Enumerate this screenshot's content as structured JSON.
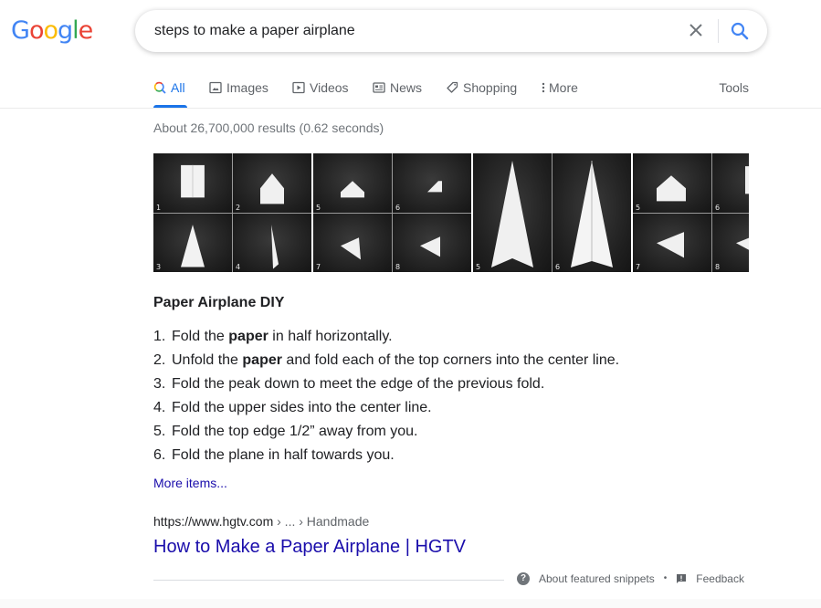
{
  "logo": {
    "letters": [
      "G",
      "o",
      "o",
      "g",
      "l",
      "e"
    ]
  },
  "search": {
    "query": "steps to make a paper airplane",
    "clear_icon": "close-icon",
    "search_icon": "magnifier-icon"
  },
  "tabs": [
    {
      "label": "All",
      "icon": "search-icon",
      "active": true
    },
    {
      "label": "Images",
      "icon": "image-icon"
    },
    {
      "label": "Videos",
      "icon": "play-icon"
    },
    {
      "label": "News",
      "icon": "newspaper-icon"
    },
    {
      "label": "Shopping",
      "icon": "tag-icon"
    },
    {
      "label": "More",
      "icon": "vertical-dots-icon"
    }
  ],
  "tools_label": "Tools",
  "result_stats": "About 26,700,000 results (0.62 seconds)",
  "images": {
    "panels": [
      {
        "layout": "grid4",
        "numbers": [
          "1",
          "2",
          "3",
          "4"
        ]
      },
      {
        "layout": "grid4",
        "numbers": [
          "5",
          "6",
          "7",
          "8"
        ]
      },
      {
        "layout": "grid2",
        "numbers": [
          "5",
          "6"
        ]
      },
      {
        "layout": "grid4",
        "numbers": [
          "5",
          "6",
          "7",
          "8"
        ]
      }
    ]
  },
  "snippet": {
    "title": "Paper Airplane DIY",
    "steps": [
      {
        "num": "1.",
        "parts": [
          {
            "t": "Fold the "
          },
          {
            "t": "paper",
            "b": true
          },
          {
            "t": " in half horizontally."
          }
        ]
      },
      {
        "num": "2.",
        "parts": [
          {
            "t": "Unfold the "
          },
          {
            "t": "paper",
            "b": true
          },
          {
            "t": " and fold each of the top corners into the center line."
          }
        ]
      },
      {
        "num": "3.",
        "parts": [
          {
            "t": "Fold the peak down to meet the edge of the previous fold."
          }
        ]
      },
      {
        "num": "4.",
        "parts": [
          {
            "t": "Fold the upper sides into the center line."
          }
        ]
      },
      {
        "num": "5.",
        "parts": [
          {
            "t": "Fold the top edge 1/2” away from you."
          }
        ]
      },
      {
        "num": "6.",
        "parts": [
          {
            "t": "Fold the plane in half towards you."
          }
        ]
      }
    ],
    "more_items": "More items..."
  },
  "result": {
    "cite_domain": "https://www.hgtv.com",
    "cite_path": " › ... › Handmade",
    "title": "How to Make a Paper Airplane | HGTV"
  },
  "footer": {
    "about": "About featured snippets",
    "separator": "•",
    "feedback": "Feedback"
  }
}
